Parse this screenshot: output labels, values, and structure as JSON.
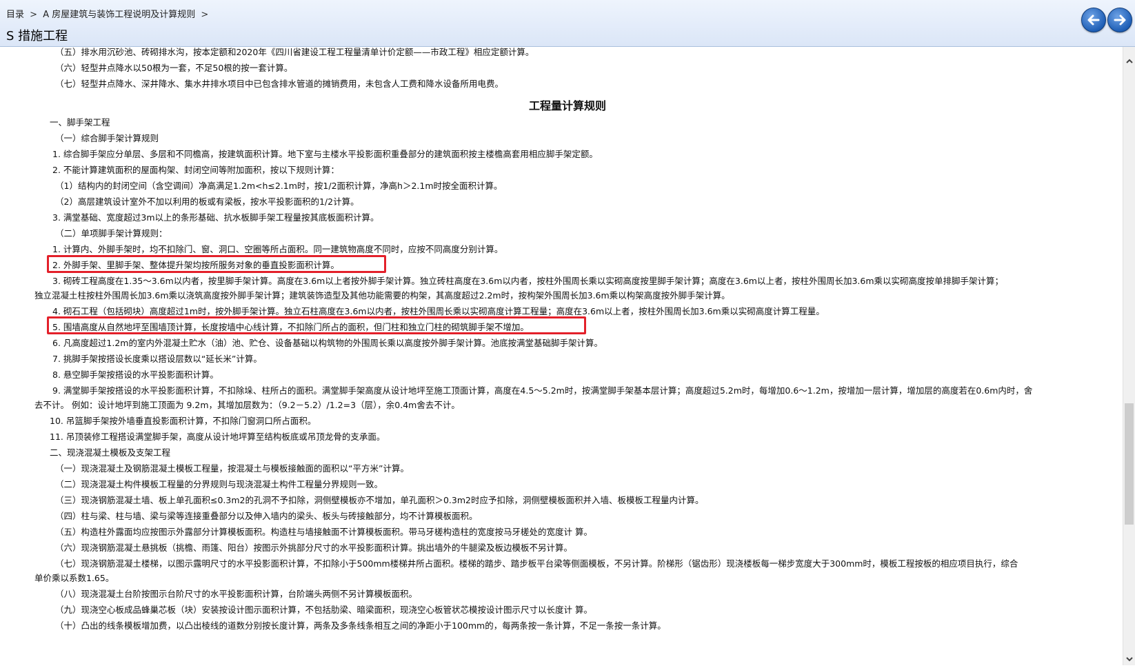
{
  "header": {
    "breadcrumb": [
      "目录",
      ">",
      "A 房屋建筑与装饰工程说明及计算规则",
      ">"
    ],
    "title": "S 措施工程",
    "back_label": "",
    "forward_label": ""
  },
  "content": {
    "lines": [
      "（五）排水用沉砂池、砖砌排水沟，按本定额和2020年《四川省建设工程工程量清单计价定额——市政工程》相应定额计算。",
      "（六）轻型井点降水以50根为一套，不足50根的按一套计算。",
      "（七）轻型井点降水、深井降水、集水井排水项目中已包含排水管道的摊销费用，未包含人工费和降水设备所用电费。",
      "工程量计算规则",
      "一、脚手架工程",
      "（一）综合脚手架计算规则",
      "1. 综合脚手架应分单层、多层和不同檐高，按建筑面积计算。地下室与主楼水平投影面积重叠部分的建筑面积按主楼檐高套用相应脚手架定额。",
      "2. 不能计算建筑面积的屋面构架、封闭空间等附加面积，按以下规则计算：",
      "（1）结构内的封闭空间（含空调间）净高满足1.2m<h≤2.1m时，按1/2面积计算，净高h＞2.1m时按全面积计算。",
      "（2）高层建筑设计室外不加以利用的板或有梁板，按水平投影面积的1/2计算。",
      "3. 满堂基础、宽度超过3m以上的条形基础、抗水板脚手架工程量按其底板面积计算。",
      "（二）单项脚手架计算规则：",
      "1.  计算内、外脚手架时，均不扣除门、窗、洞口、空圈等所占面积。同一建筑物高度不同时，应按不同高度分别计算。",
      "2.  外脚手架、里脚手架、整体提升架均按所服务对象的垂直投影面积计算。",
      "3.  砌砖工程高度在1.35～3.6m以内者，按里脚手架计算。高度在3.6m以上者按外脚手架计算。独立砖柱高度在3.6m以内者，按柱外围周长乘以实砌高度按里脚手架计算；高度在3.6m以上者，按柱外围周长加3.6m乘以实砌高度按单排脚手架计算；",
      "独立混凝土柱按柱外围周长加3.6m乘以浇筑高度按外脚手架计算；建筑装饰造型及其他功能需要的构架，其高度超过2.2m时，按构架外围周长加3.6m乘以构架高度按外脚手架计算。",
      "4.  砌石工程（包括砌块）高度超过1m时，按外脚手架计算。独立石柱高度在3.6m以内者，按柱外围周长乘以实砌高度计算工程量；高度在3.6m以上者，按柱外围周长加3.6m乘以实砌高度计算工程量。",
      "5.  围墙高度从自然地坪至围墙顶计算，长度按墙中心线计算，不扣除门所占的面积，但门柱和独立门柱的砌筑脚手架不增加。",
      "6.  凡高度超过1.2m的室内外混凝土贮水（油）池、贮仓、设备基础以构筑物的外围周长乘以高度按外脚手架计算。池底按满堂基础脚手架计算。",
      "7.  挑脚手架按搭设长度乘以搭设层数以“延长米”计算。",
      "8.  悬空脚手架按搭设的水平投影面积计算。",
      "9.    满堂脚手架按搭设的水平投影面积计算，不扣除垛、柱所占的面积。满堂脚手架高度从设计地坪至施工顶面计算，高度在4.5～5.2m时，按满堂脚手架基本层计算；高度超过5.2m时，每增加0.6～1.2m，按增加一层计算，增加层的高度若在0.6m内时，舍",
      "去不计。 例如：设计地坪到施工顶面为 9.2m，其增加层数为：（9.2－5.2）/1.2=3（层），余0.4m舍去不计。",
      "10. 吊篮脚手架按外墙垂直投影面积计算，不扣除门窗洞口所占面积。",
      "11. 吊顶装修工程搭设满堂脚手架，高度从设计地坪算至结构板底或吊顶龙骨的支承面。",
      "二、现浇混凝土模板及支架工程",
      "（一）现浇混凝土及钢筋混凝土模板工程量，按混凝土与模板接触面的面积以“平方米”计算。",
      "（二）现浇混凝土构件模板工程量的分界规则与现浇混凝土构件工程量分界规则一致。",
      "（三）现浇钢筋混凝土墙、板上单孔面积≤0.3m2的孔洞不予扣除，洞侧壁模板亦不增加，单孔面积＞0.3m2时应予扣除，洞侧壁模板面积并入墙、板模板工程量内计算。",
      "（四）柱与梁、柱与墙、梁与梁等连接重叠部分以及伸入墙内的梁头、板头与砖接触部分，均不计算模板面积。",
      "（五）构造柱外露面均应按图示外露部分计算模板面积。构造柱与墙接触面不计算模板面积。带马牙槎构造柱的宽度按马牙槎处的宽度计 算。",
      "（六）现浇钢筋混凝土悬挑板（挑檐、雨篷、阳台）按图示外挑部分尺寸的水平投影面积计算。挑出墙外的牛腿梁及板边模板不另计算。",
      "（七）现浇钢筋混凝土楼梯，以图示露明尺寸的水平投影面积计算，不扣除小于500mm楼梯井所占面积。楼梯的踏步、踏步板平台梁等侧面模板，不另计算。阶梯形（锯齿形）现浇楼板每一梯步宽度大于300mm时，模板工程按板的相应项目执行，综合",
      "单价乘以系数1.65。",
      "（八）现浇混凝土台阶按图示台阶尺寸的水平投影面积计算，台阶端头两侧不另计算模板面积。",
      "（九）现浇空心板成品蜂巢芯板（块）安装按设计图示面积计算，不包括肋梁、暗梁面积，现浇空心板管状芯模按设计图示尺寸以长度计 算。",
      "（十）凸出的线条模板增加费，以凸出棱线的道数分别按长度计算，两条及多条线条相互之间的净距小于100mm的，每两条按一条计算，不足一条按一条计算。"
    ]
  }
}
